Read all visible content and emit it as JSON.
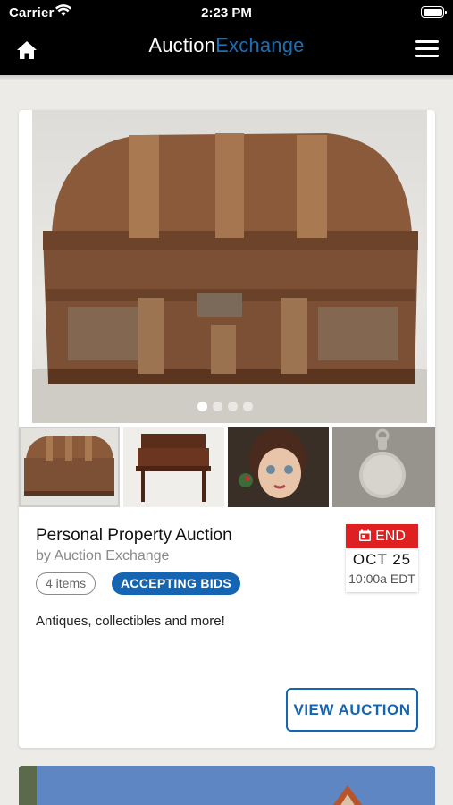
{
  "status_bar": {
    "carrier": "Carrier",
    "time": "2:23 PM"
  },
  "nav": {
    "logo_part1": "Auction",
    "logo_part2": "Exchange",
    "home_icon": "home-icon",
    "menu_icon": "hamburger-menu-icon"
  },
  "auction": {
    "title": "Personal Property Auction",
    "byline": "by Auction Exchange",
    "items_count": "4 items",
    "status": "ACCEPTING BIDS",
    "description": "Antiques, collectibles and more!",
    "end_label": "END",
    "end_date": "OCT 25",
    "end_time": "10:00a EDT",
    "view_button": "VIEW AUCTION",
    "carousel_pages": 4,
    "carousel_active": 1
  },
  "colors": {
    "brand_blue": "#1565b2",
    "end_red": "#e02020",
    "nav_bg": "#000000"
  }
}
